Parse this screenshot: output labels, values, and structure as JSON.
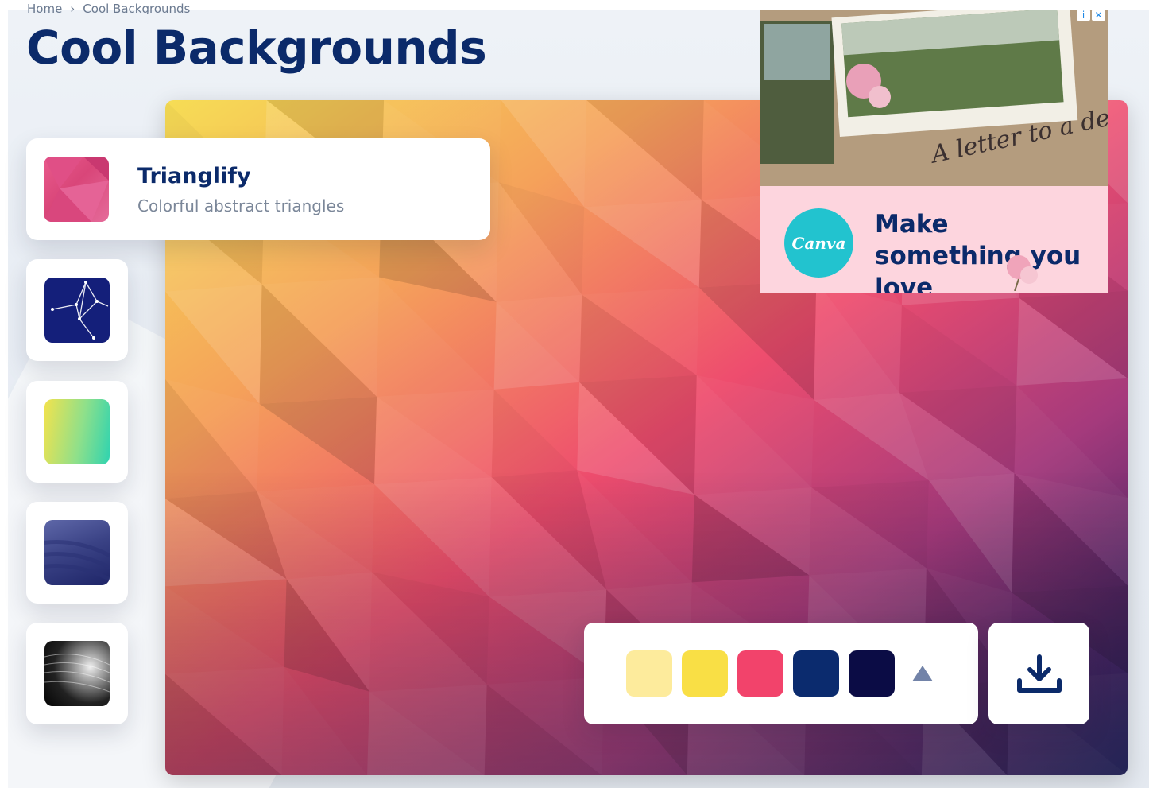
{
  "breadcrumb": {
    "home": "Home",
    "separator": "›",
    "current": "Cool Backgrounds"
  },
  "page_title": "Cool Backgrounds",
  "feature": {
    "title": "Trianglify",
    "subtitle": "Colorful abstract triangles"
  },
  "style_options": [
    {
      "name": "constellation"
    },
    {
      "name": "gradient"
    },
    {
      "name": "waves"
    },
    {
      "name": "monochrome-swirl"
    }
  ],
  "ad": {
    "brand": "Canva",
    "headline": "Make something you love",
    "photo_caption": "A letter to a dear friend",
    "info_badge": "i",
    "close_badge": "✕"
  },
  "palette": {
    "swatches": [
      "#fdeb9c",
      "#f9df45",
      "#f2436b",
      "#0b2b6e",
      "#0b0c45"
    ],
    "toggle_icon": "triangle-up-icon"
  },
  "download": {
    "icon": "download-icon"
  },
  "colors": {
    "title": "#0b2a6a",
    "accent_gradient_start": "#f5d24f",
    "accent_gradient_mid": "#ee4d6e",
    "accent_gradient_end": "#101a5c"
  }
}
